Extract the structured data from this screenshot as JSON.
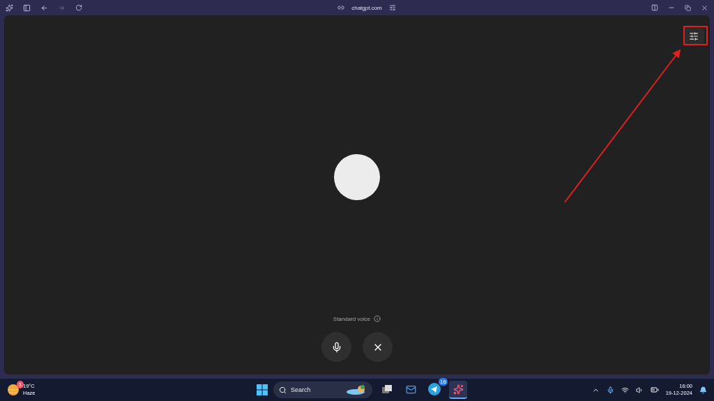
{
  "browser": {
    "url": "chatgpt.com"
  },
  "voice": {
    "label": "Standard voice"
  },
  "taskbar": {
    "weather": {
      "temperature": "19°C",
      "condition": "Haze",
      "badge": "1"
    },
    "search": {
      "placeholder": "Search"
    },
    "apps": [
      {
        "kind": "files",
        "selected": false
      },
      {
        "kind": "outlook",
        "selected": false
      },
      {
        "kind": "telegram",
        "selected": false,
        "badge": "16"
      },
      {
        "kind": "browser",
        "selected": true
      }
    ],
    "time": "16:00",
    "date": "19-12-2024"
  }
}
